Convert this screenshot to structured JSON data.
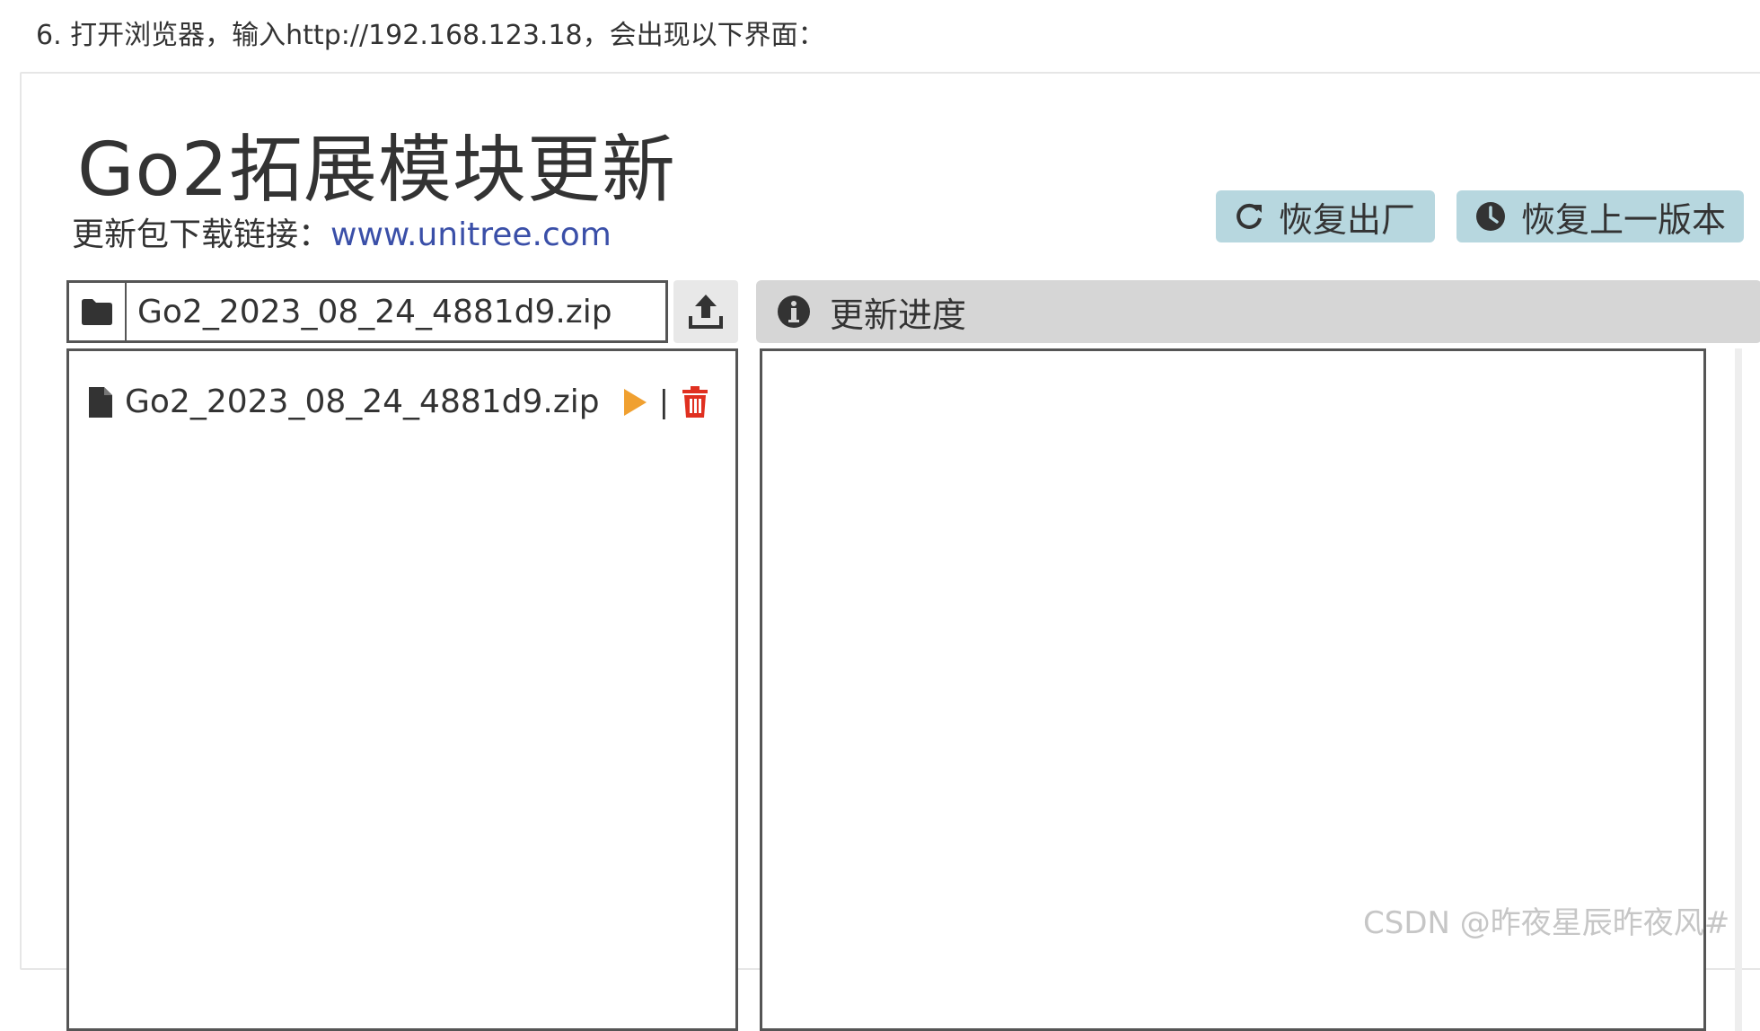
{
  "intro_text": "6. 打开浏览器，输入http://192.168.123.18，会出现以下界面：",
  "page_title": "Go2拓展模块更新",
  "download": {
    "label": "更新包下载链接：",
    "link_text": "www.unitree.com"
  },
  "buttons": {
    "restore_factory": {
      "label": "恢复出厂",
      "icon": "refresh-icon"
    },
    "restore_previous": {
      "label": "恢复上一版本",
      "icon": "clock-icon"
    }
  },
  "file_picker": {
    "selected_file": "Go2_2023_08_24_4881d9.zip",
    "folder_icon": "folder-icon",
    "upload_icon": "upload-icon"
  },
  "progress": {
    "header": "更新进度",
    "icon": "info-icon"
  },
  "files": [
    {
      "name": "Go2_2023_08_24_4881d9.zip",
      "separator": "|",
      "play_icon": "play-icon",
      "delete_icon": "trash-icon"
    }
  ],
  "colors": {
    "button_bg": "#b7d7df",
    "link": "#3a4fa8",
    "play": "#f0a030",
    "delete": "#e03020",
    "progress_header_bg": "#d6d6d6"
  },
  "watermark": "CSDN @昨夜星辰昨夜风#"
}
